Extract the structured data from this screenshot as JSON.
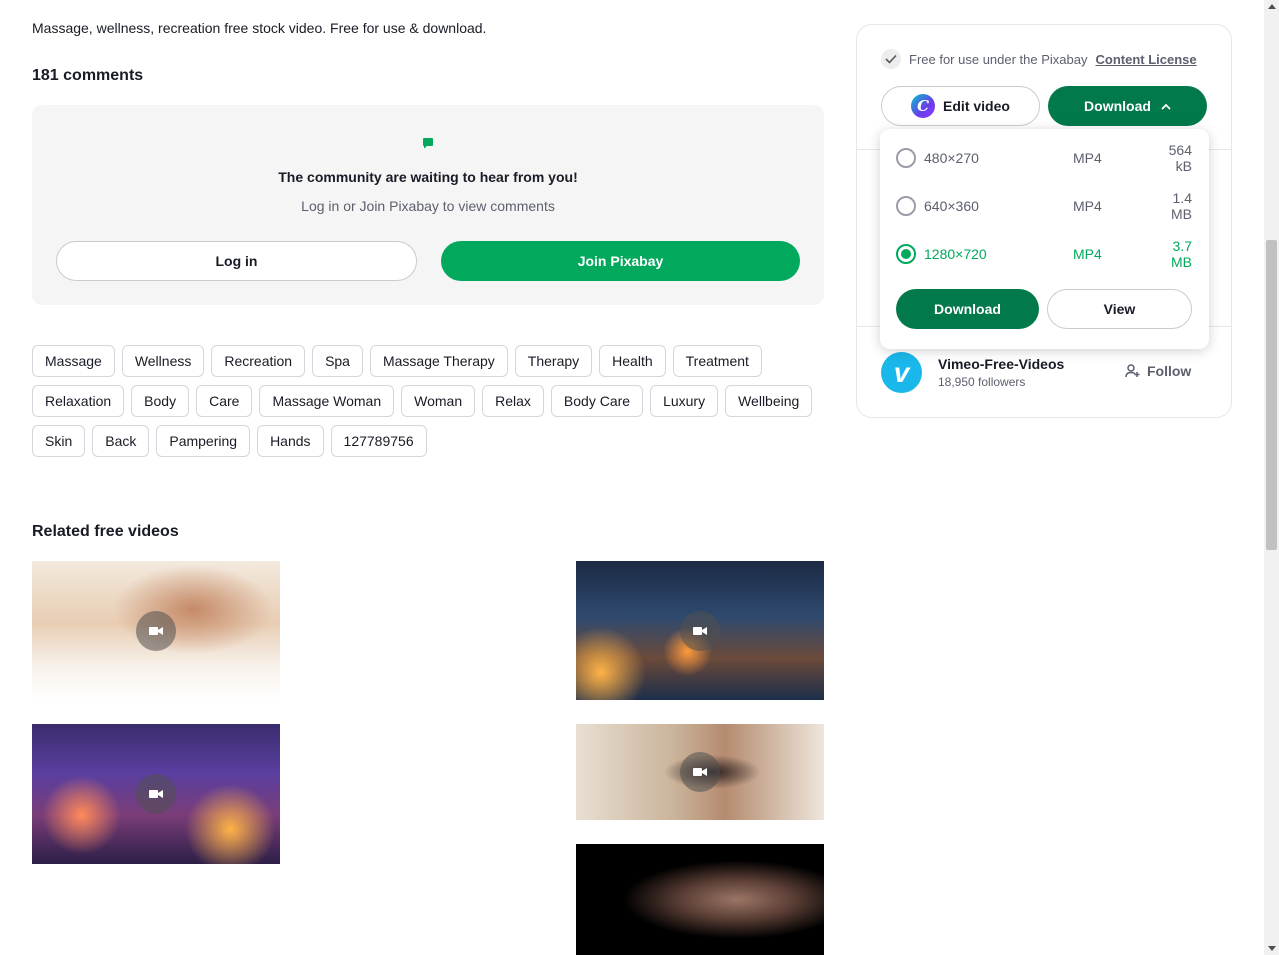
{
  "description": "Massage, wellness, recreation free stock video. Free for use & download.",
  "comments": {
    "title": "181 comments",
    "community_text": "The community are waiting to hear from you!",
    "login_hint": "Log in or Join Pixabay to view comments",
    "login_label": "Log in",
    "join_label": "Join Pixabay"
  },
  "tags": [
    "Massage",
    "Wellness",
    "Recreation",
    "Spa",
    "Massage Therapy",
    "Therapy",
    "Health",
    "Treatment",
    "Relaxation",
    "Body",
    "Care",
    "Massage Woman",
    "Woman",
    "Relax",
    "Body Care",
    "Luxury",
    "Wellbeing",
    "Skin",
    "Back",
    "Pampering",
    "Hands",
    "127789756"
  ],
  "related": {
    "title": "Related free videos"
  },
  "panel": {
    "license_text": "Free for use under the Pixabay",
    "license_link": "Content License",
    "edit_label": "Edit video",
    "download_label": "Download"
  },
  "download_options": [
    {
      "resolution": "480×270",
      "format": "MP4",
      "size": "564 kB",
      "selected": false
    },
    {
      "resolution": "640×360",
      "format": "MP4",
      "size": "1.4 MB",
      "selected": false
    },
    {
      "resolution": "1280×720",
      "format": "MP4",
      "size": "3.7 MB",
      "selected": true
    }
  ],
  "dropdown": {
    "download_label": "Download",
    "view_label": "View"
  },
  "author": {
    "name": "Vimeo-Free-Videos",
    "followers": "18,950 followers",
    "follow_label": "Follow"
  },
  "colors": {
    "brand_green": "#02a95c",
    "dark_green": "#02794a"
  }
}
